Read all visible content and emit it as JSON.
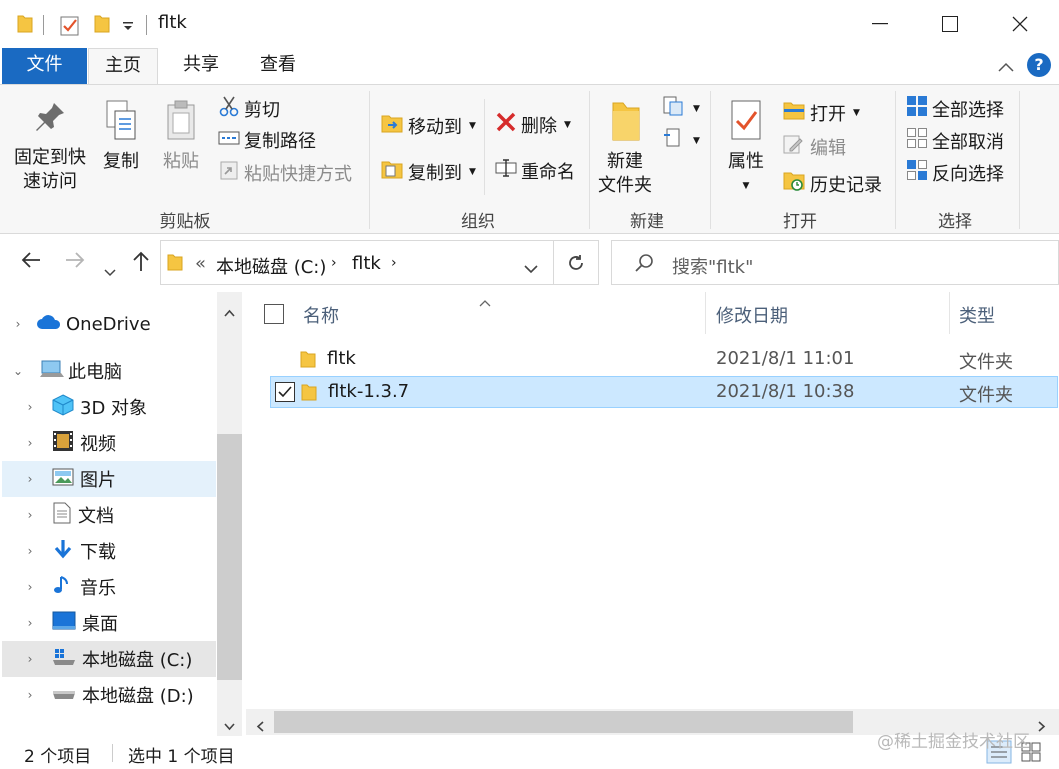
{
  "window": {
    "title": "fltk",
    "minimize": "—",
    "maximize": "☐",
    "close": "✕"
  },
  "tabs": [
    "文件",
    "主页",
    "共享",
    "查看"
  ],
  "ribbon": {
    "clipboard": {
      "label": "剪贴板",
      "pin_line1": "固定到快",
      "pin_line2": "速访问",
      "copy": "复制",
      "paste": "粘贴",
      "cut": "剪切",
      "copy_path": "复制路径",
      "paste_shortcut": "粘贴快捷方式"
    },
    "organize": {
      "label": "组织",
      "move_to": "移动到",
      "copy_to": "复制到",
      "delete": "删除",
      "rename": "重命名"
    },
    "new": {
      "label": "新建",
      "new_folder_line1": "新建",
      "new_folder_line2": "文件夹"
    },
    "open": {
      "label": "打开",
      "properties": "属性",
      "open": "打开",
      "edit": "编辑",
      "history": "历史记录"
    },
    "select": {
      "label": "选择",
      "select_all": "全部选择",
      "select_none": "全部取消",
      "invert": "反向选择"
    }
  },
  "address": {
    "prefix": "«",
    "crumb1": "本地磁盘 (C:)",
    "crumb2": "fltk",
    "search_placeholder": "搜索\"fltk\""
  },
  "nav_pane": {
    "items": [
      {
        "label": "OneDrive"
      },
      {
        "label": "此电脑"
      },
      {
        "label": "3D 对象"
      },
      {
        "label": "视频"
      },
      {
        "label": "图片"
      },
      {
        "label": "文档"
      },
      {
        "label": "下载"
      },
      {
        "label": "音乐"
      },
      {
        "label": "桌面"
      },
      {
        "label": "本地磁盘 (C:)"
      },
      {
        "label": "本地磁盘 (D:)"
      }
    ]
  },
  "file_list": {
    "columns": [
      "名称",
      "修改日期",
      "类型"
    ],
    "rows": [
      {
        "name": "fltk",
        "date": "2021/8/1 11:01",
        "type": "文件夹",
        "selected": false
      },
      {
        "name": "fltk-1.3.7",
        "date": "2021/8/1 10:38",
        "type": "文件夹",
        "selected": true
      }
    ]
  },
  "status": {
    "count": "2 个项目",
    "selected": "选中 1 个项目"
  },
  "watermark": "@稀土掘金技术社区",
  "colors": {
    "accent": "#1a6ac2",
    "folder": "#f5c542",
    "selection": "#cce8ff"
  }
}
